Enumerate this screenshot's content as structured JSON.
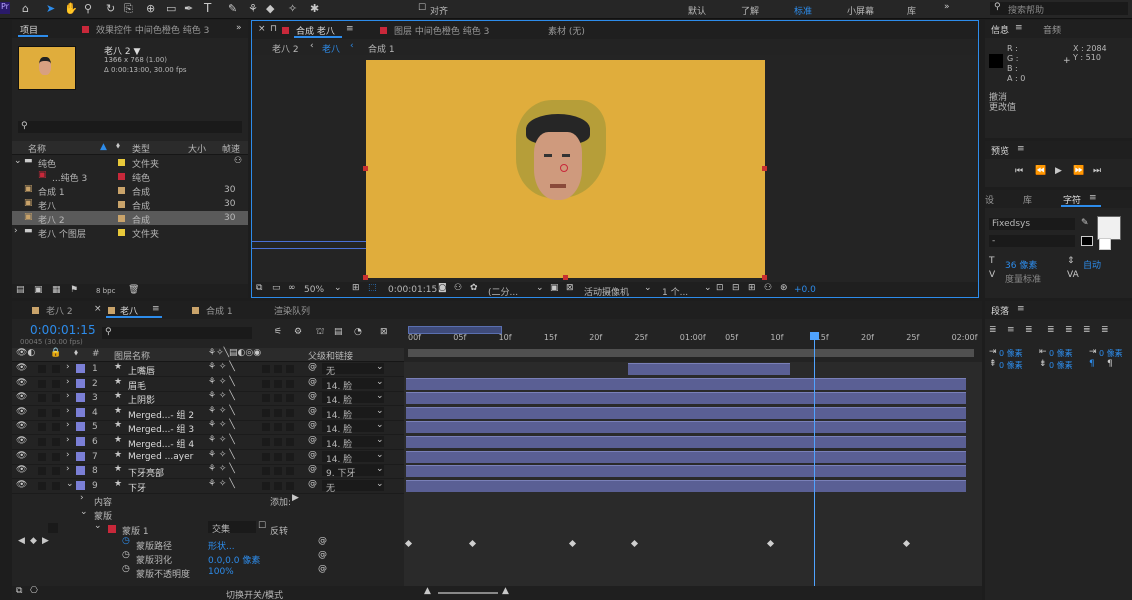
{
  "toolbar": {
    "workspaces": [
      "默认",
      "了解",
      "标准",
      "小屏幕",
      "库"
    ],
    "active_workspace": "标准",
    "search_placeholder": "搜索帮助",
    "align_label": "对齐"
  },
  "project_panel": {
    "tab_label": "项目",
    "effects_tab": "效果控件 中间色橙色 纯色 3",
    "item_name": "老八 2 ▼",
    "item_info1": "1366 x 768 (1.00)",
    "item_info2": "Δ 0:00:13:00, 30.00 fps",
    "columns": [
      "名称",
      "类型",
      "大小",
      "帧速"
    ],
    "items": [
      {
        "name": "纯色",
        "type": "文件夹",
        "fps": "",
        "color": "#e8c93a"
      },
      {
        "name": "...纯色 3",
        "type": "纯色",
        "fps": "",
        "color": "#c8283a"
      },
      {
        "name": "合成 1",
        "type": "合成",
        "fps": "30",
        "color": "#c9a36a"
      },
      {
        "name": "老八",
        "type": "合成",
        "fps": "30",
        "color": "#c9a36a"
      },
      {
        "name": "老八 2",
        "type": "合成",
        "fps": "30",
        "color": "#c9a36a"
      },
      {
        "name": "老八 个图层",
        "type": "文件夹",
        "fps": "",
        "color": "#e8c93a"
      }
    ],
    "bpc": "8 bpc"
  },
  "comp_viewer": {
    "tab_comp": "合成 老八",
    "tab_layer": "图层 中间色橙色 纯色 3",
    "tab_material": "素材 (无)",
    "breadcrumbs": [
      "老八 2",
      "老八",
      "合成 1"
    ],
    "zoom": "50%",
    "timecode": "0:00:01:15",
    "resolution": "(二分...",
    "camera": "活动摄像机",
    "views": "1 个...",
    "exposure": "+0.0"
  },
  "info_panel": {
    "tab_info": "信息",
    "tab_audio": "音频",
    "r": "R :",
    "g": "G :",
    "b": "B :",
    "a": "A : 0",
    "x": "X : 2084",
    "y": "Y : 510",
    "undo": "撤消",
    "undo2": "更改值"
  },
  "preview_panel": {
    "tab": "预览"
  },
  "char_panel": {
    "tabs": [
      "设",
      "库",
      "字符"
    ],
    "font": "Fixedsys",
    "style": "-",
    "size": "36 像素",
    "leading": "自动",
    "tracking": "度量标准"
  },
  "para_panel": {
    "tab": "段落",
    "indent_values": [
      "0 像素",
      "0 像素",
      "0 像素",
      "0 像素",
      "0 像素"
    ]
  },
  "timeline": {
    "tabs": [
      "老八 2",
      "老八",
      "合成 1",
      "渲染队列"
    ],
    "timecode": "0:00:01:15",
    "frames": "00045 (30.00 fps)",
    "col_layer_name": "图层名称",
    "col_parent": "父级和链接",
    "ruler": [
      "00f",
      "05f",
      "10f",
      "15f",
      "20f",
      "25f",
      "01:00f",
      "05f",
      "10f",
      "15f",
      "20f",
      "25f",
      "02:00f"
    ],
    "layers": [
      {
        "num": "1",
        "name": "上嘴唇",
        "parent": "无",
        "color": "#7b7fd6"
      },
      {
        "num": "2",
        "name": "眉毛",
        "parent": "14. 脸",
        "color": "#7b7fd6"
      },
      {
        "num": "3",
        "name": "上阴影",
        "parent": "14. 脸",
        "color": "#7b7fd6"
      },
      {
        "num": "4",
        "name": "Merged...- 组 2",
        "parent": "14. 脸",
        "color": "#7b7fd6"
      },
      {
        "num": "5",
        "name": "Merged...- 组 3",
        "parent": "14. 脸",
        "color": "#7b7fd6"
      },
      {
        "num": "6",
        "name": "Merged...- 组 4",
        "parent": "14. 脸",
        "color": "#7b7fd6"
      },
      {
        "num": "7",
        "name": "Merged ...ayer",
        "parent": "14. 脸",
        "color": "#7b7fd6"
      },
      {
        "num": "8",
        "name": "下牙亮部",
        "parent": "9. 下牙",
        "color": "#7b7fd6"
      },
      {
        "num": "9",
        "name": "下牙",
        "parent": "无",
        "color": "#7b7fd6"
      }
    ],
    "sub_content": "内容",
    "sub_add": "添加:",
    "sub_mask_group": "蒙版",
    "mask_name": "蒙版 1",
    "mask_mode": "交集",
    "mask_invert": "反转",
    "mask_path_label": "蒙版路径",
    "mask_path_value": "形状...",
    "mask_feather_label": "蒙版羽化",
    "mask_feather_value": "0.0,0.0 像素",
    "mask_opacity_label": "蒙版不透明度",
    "mask_opacity_value": "100%",
    "toggle_label": "切换开关/模式"
  }
}
